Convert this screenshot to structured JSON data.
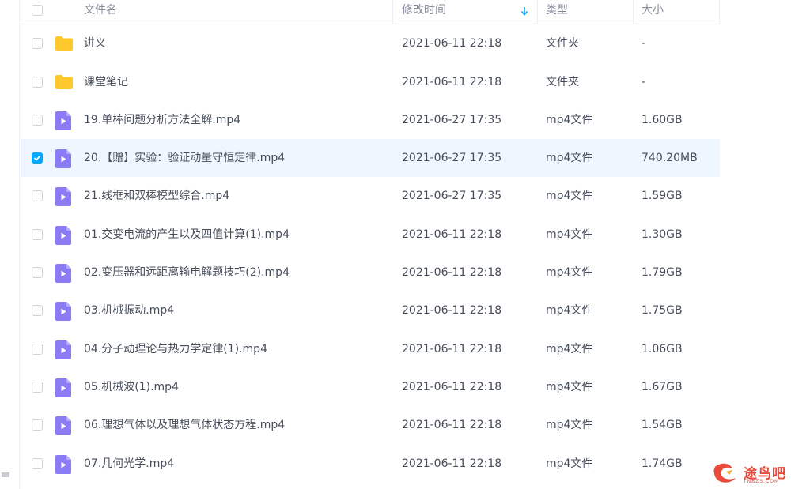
{
  "header": {
    "name": "文件名",
    "time": "修改时间",
    "type": "类型",
    "size": "大小"
  },
  "rows": [
    {
      "name": "讲义",
      "time": "2021-06-11 22:18",
      "type": "文件夹",
      "size": "-",
      "icon": "folder-icon",
      "checked": false
    },
    {
      "name": "课堂笔记",
      "time": "2021-06-11 22:18",
      "type": "文件夹",
      "size": "-",
      "icon": "folder-icon",
      "checked": false
    },
    {
      "name": "19.单棒问题分析方法全解.mp4",
      "time": "2021-06-27 17:35",
      "type": "mp4文件",
      "size": "1.60GB",
      "icon": "video-file-icon",
      "checked": false
    },
    {
      "name": "20.【赠】实验：验证动量守恒定律.mp4",
      "time": "2021-06-27 17:35",
      "type": "mp4文件",
      "size": "740.20MB",
      "icon": "video-file-icon",
      "checked": true
    },
    {
      "name": "21.线框和双棒模型综合.mp4",
      "time": "2021-06-27 17:35",
      "type": "mp4文件",
      "size": "1.59GB",
      "icon": "video-file-icon",
      "checked": false
    },
    {
      "name": "01.交变电流的产生以及四值计算(1).mp4",
      "time": "2021-06-11 22:18",
      "type": "mp4文件",
      "size": "1.30GB",
      "icon": "video-file-icon",
      "checked": false
    },
    {
      "name": "02.变压器和远距离输电解题技巧(2).mp4",
      "time": "2021-06-11 22:18",
      "type": "mp4文件",
      "size": "1.79GB",
      "icon": "video-file-icon",
      "checked": false
    },
    {
      "name": "03.机械振动.mp4",
      "time": "2021-06-11 22:18",
      "type": "mp4文件",
      "size": "1.75GB",
      "icon": "video-file-icon",
      "checked": false
    },
    {
      "name": "04.分子动理论与热力学定律(1).mp4",
      "time": "2021-06-11 22:18",
      "type": "mp4文件",
      "size": "1.06GB",
      "icon": "video-file-icon",
      "checked": false
    },
    {
      "name": "05.机械波(1).mp4",
      "time": "2021-06-11 22:18",
      "type": "mp4文件",
      "size": "1.67GB",
      "icon": "video-file-icon",
      "checked": false
    },
    {
      "name": "06.理想气体以及理想气体状态方程.mp4",
      "time": "2021-06-11 22:18",
      "type": "mp4文件",
      "size": "1.54GB",
      "icon": "video-file-icon",
      "checked": false
    },
    {
      "name": "07.几何光学.mp4",
      "time": "2021-06-11 22:18",
      "type": "mp4文件",
      "size": "1.74GB",
      "icon": "video-file-icon",
      "checked": false
    }
  ],
  "watermark": {
    "text": "途鸟吧",
    "sub": "TNBZS.COM"
  },
  "colors": {
    "accent": "#06a7ff",
    "folder": "#ffc82c",
    "video": "#8b7cf6",
    "selected_row": "#eef6ff"
  }
}
